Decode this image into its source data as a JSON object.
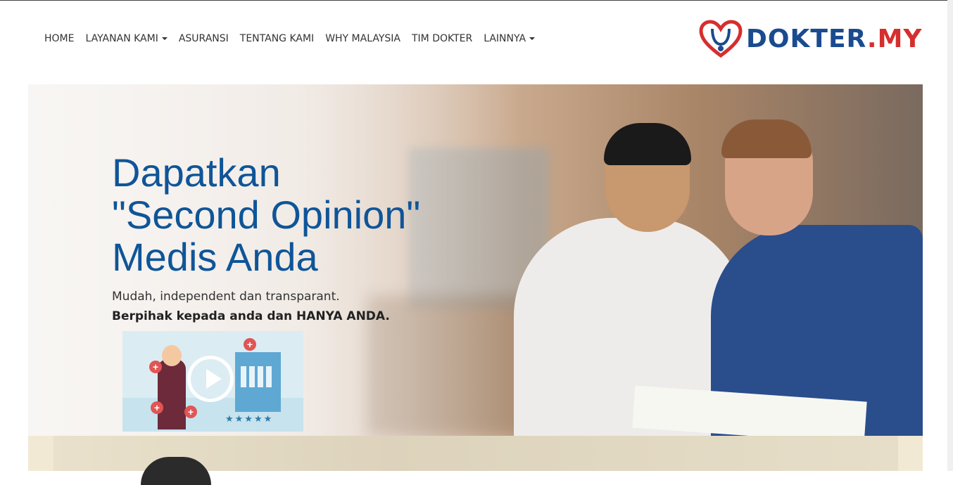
{
  "nav": {
    "items": [
      {
        "label": "HOME",
        "dropdown": false
      },
      {
        "label": "LAYANAN KAMI",
        "dropdown": true
      },
      {
        "label": "ASURANSI",
        "dropdown": false
      },
      {
        "label": "TENTANG KAMI",
        "dropdown": false
      },
      {
        "label": "WHY MALAYSIA",
        "dropdown": false
      },
      {
        "label": "TIM DOKTER",
        "dropdown": false
      },
      {
        "label": "LAINNYA",
        "dropdown": true
      }
    ]
  },
  "logo": {
    "part1": "DOKTER",
    "part2": ".MY",
    "icon": "heart-stethoscope-icon"
  },
  "hero": {
    "title_line1": "Dapatkan",
    "title_line2": "\"Second Opinion\"",
    "title_line3": "Medis Anda",
    "subtitle": "Mudah, independent dan transparant.",
    "subtitle_bold": "Berpihak kepada anda dan HANYA ANDA.",
    "video_icon": "play-icon",
    "video_rating": "★★★★★"
  },
  "colors": {
    "brand_blue": "#1a4b8e",
    "brand_red": "#d62e2e",
    "title_blue": "#0f5598"
  }
}
